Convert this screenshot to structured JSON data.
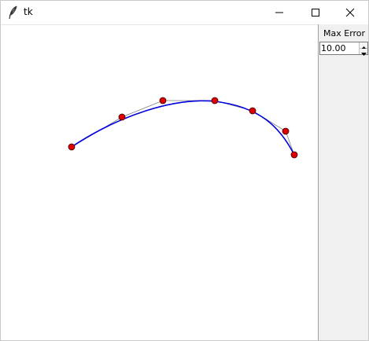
{
  "window": {
    "title": "tk",
    "icons": {
      "app": "feather-icon",
      "minimize": "minimize-icon",
      "maximize": "maximize-icon",
      "close": "close-icon"
    }
  },
  "panel": {
    "label": "Max Error",
    "spinbox_value": "10.00"
  },
  "canvas": {
    "colors": {
      "control_point_fill": "#dd0000",
      "control_point_stroke": "#400000",
      "polyline": "#808080",
      "curve": "#0000dd"
    },
    "control_point_count": 7
  }
}
